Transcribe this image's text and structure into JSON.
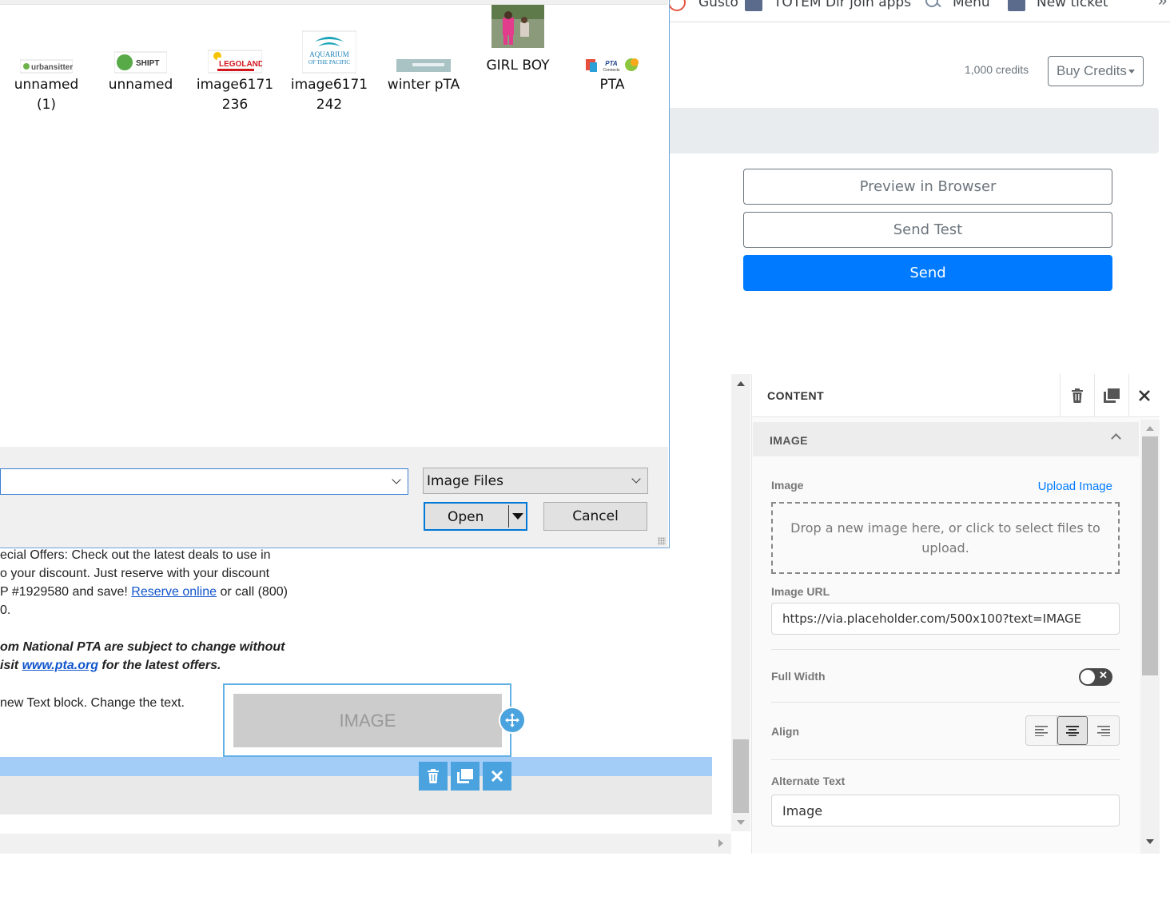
{
  "bookmarks": {
    "items": [
      {
        "label": "Gusto",
        "icon": "gusto-icon"
      },
      {
        "label": "TOTEM Dir join apps",
        "icon": "freshdesk-icon"
      },
      {
        "label": "Menu",
        "icon": "search-icon"
      },
      {
        "label": "New ticket",
        "icon": "freshdesk-icon"
      }
    ],
    "more": "»"
  },
  "header": {
    "credits": "1,000 credits",
    "buy_credits": "Buy Credits"
  },
  "actions": {
    "preview": "Preview in Browser",
    "send_test": "Send Test",
    "send": "Send"
  },
  "dialog": {
    "files": [
      {
        "name": "unnamed\n(1)",
        "thumb": "urbansitter"
      },
      {
        "name": "unnamed",
        "thumb": "SHIPT"
      },
      {
        "name": "image6171\n236",
        "thumb": "LEGOLAND"
      },
      {
        "name": "image6171\n242",
        "thumb": "AQUARIUM OF THE PACIFIC"
      },
      {
        "name": "winter pTA",
        "thumb": "banner"
      },
      {
        "name": "GIRL BOY",
        "thumb": "photo"
      },
      {
        "name": "PTA",
        "thumb": "PTA Connect"
      }
    ],
    "filename_value": "",
    "filter": "Image Files",
    "open": "Open",
    "cancel": "Cancel"
  },
  "email": {
    "line1": "ecial Offers: Check out the latest deals to use in",
    "line2": "o your discount. Just reserve with your discount",
    "line3_pre": "P #1929580 and save! ",
    "line3_link": "Reserve online",
    "line3_post": " or call (800)",
    "line4": "0.",
    "line5": "om National PTA are subject to change without",
    "line6_pre": "isit ",
    "line6_link": "www.pta.org",
    "line6_post": " for the latest offers.",
    "line7": "new Text block. Change the text.",
    "image_placeholder": "IMAGE"
  },
  "panel": {
    "title": "CONTENT",
    "section": "IMAGE",
    "image_label": "Image",
    "upload_link": "Upload Image",
    "dropzone": "Drop a new image here, or click to select files to upload.",
    "url_label": "Image URL",
    "url_value": "https://via.placeholder.com/500x100?text=IMAGE",
    "full_width_label": "Full Width",
    "full_width_on": false,
    "align_label": "Align",
    "align_value": "center",
    "alt_label": "Alternate Text",
    "alt_value": "Image"
  },
  "colors": {
    "primary": "#007bff",
    "editor_accent": "#4aa3df",
    "selection_row": "#a3cdf7"
  }
}
